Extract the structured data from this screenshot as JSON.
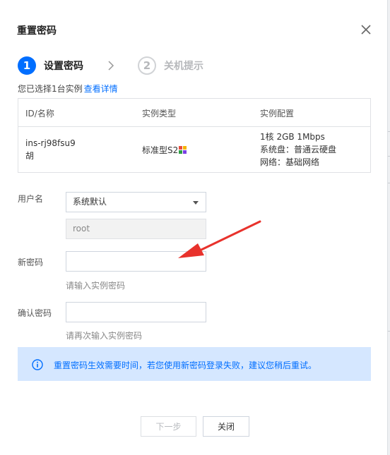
{
  "dialog": {
    "title": "重置密码"
  },
  "steps": [
    {
      "number": "1",
      "label": "设置密码",
      "state": "active"
    },
    {
      "number": "2",
      "label": "关机提示",
      "state": "inactive"
    }
  ],
  "selection": {
    "text": "您已选择1台实例",
    "link": "查看详情"
  },
  "table": {
    "headers": [
      "ID/名称",
      "实例类型",
      "实例配置"
    ],
    "row": {
      "id": "ins-rj98fsu9",
      "name": "胡",
      "type": "标准型S2",
      "config": [
        "1核 2GB 1Mbps",
        "系统盘：普通云硬盘",
        "网络：基础网络"
      ]
    }
  },
  "form": {
    "username_label": "用户名",
    "username_select_value": "系统默认",
    "username_value": "root",
    "new_password_label": "新密码",
    "new_password_hint": "请输入实例密码",
    "confirm_password_label": "确认密码",
    "confirm_password_hint": "请再次输入实例密码"
  },
  "notice": {
    "text": "重置密码生效需要时间，若您使用新密码登录失败，建议您稍后重试。"
  },
  "buttons": {
    "next": "下一步",
    "close": "关闭"
  },
  "colors": {
    "primary": "#006eff",
    "notice_bg": "#d5e7ff",
    "annotation_arrow": "#e8322c"
  },
  "icons": {
    "close": "close-icon",
    "step_separator": "chevron-right-icon",
    "info": "info-circle-icon",
    "instance_type_badge": "colorful-badge-icon",
    "select_caret": "caret-down-icon"
  }
}
